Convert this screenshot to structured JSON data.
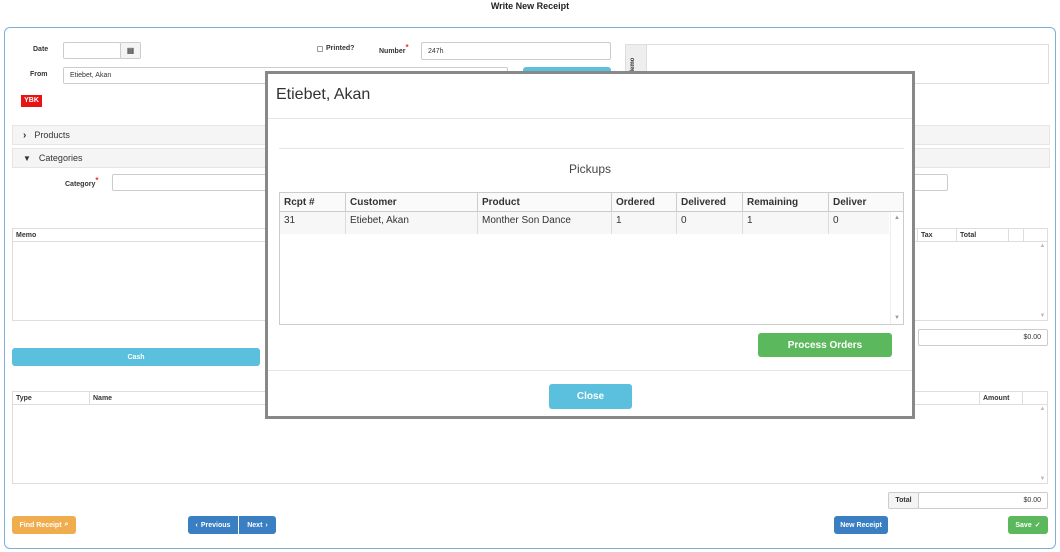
{
  "page": {
    "title": "Write New Receipt"
  },
  "form": {
    "date_label": "Date",
    "date_value": "",
    "printed_label": "Printed?",
    "number_label": "Number",
    "number_value": "247h",
    "from_label": "From",
    "from_value": "Etiebet, Akan",
    "ybk_badge": "YBK",
    "memo_side_label": "Memo",
    "products_label": "Products",
    "categories_label": "Categories",
    "category_label": "Category"
  },
  "items_grid": {
    "col_memo": "Memo",
    "col_tax": "Tax",
    "col_total": "Total",
    "subtotal_value": "$0.00"
  },
  "cash_button": "Cash",
  "payments_grid": {
    "col_type": "Type",
    "col_name": "Name",
    "col_amount": "Amount",
    "total_label": "Total",
    "total_value": "$0.00"
  },
  "footer": {
    "find_receipt": "Find Receipt",
    "previous": "Previous",
    "next": "Next",
    "new_receipt": "New Receipt",
    "save": "Save"
  },
  "modal": {
    "title": "Etiebet, Akan",
    "section_title": "Pickups",
    "columns": [
      "Rcpt #",
      "Customer",
      "Product",
      "Ordered",
      "Delivered",
      "Remaining",
      "Deliver"
    ],
    "rows": [
      {
        "rcpt": "31",
        "customer": "Etiebet, Akan",
        "product": "Monther Son Dance",
        "ordered": "1",
        "delivered": "0",
        "remaining": "1",
        "deliver": "0"
      }
    ],
    "process_button": "Process Orders",
    "close_button": "Close"
  },
  "colors": {
    "primary_blue": "#3a7fc1",
    "info_blue": "#5bc0de",
    "success_green": "#5cb85c",
    "warning_orange": "#f0ad4e",
    "badge_red": "#e81414"
  }
}
